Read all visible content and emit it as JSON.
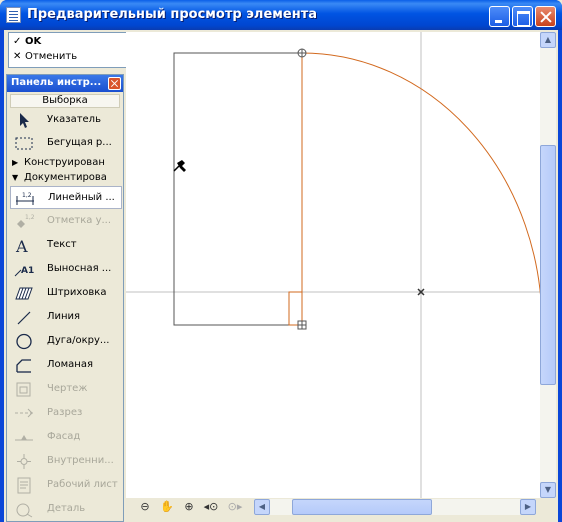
{
  "window": {
    "title": "Предварительный просмотр элемента",
    "controls": {
      "minimize": "minimize-icon",
      "maximize": "maximize-icon",
      "close": "close-icon"
    }
  },
  "dialog": {
    "ok_label": "OK",
    "cancel_label": "Отменить"
  },
  "toolbox": {
    "title": "Панель инстр...",
    "section": "Выборка",
    "select_tools": [
      {
        "label": "Указатель",
        "icon": "arrow-pointer-icon",
        "enabled": true
      },
      {
        "label": "Бегущая р...",
        "icon": "marquee-icon",
        "enabled": true
      }
    ],
    "groups": [
      {
        "label": "Конструирован",
        "expanded": false
      },
      {
        "label": "Документирова",
        "expanded": true
      }
    ],
    "doc_tools": [
      {
        "label": "Линейный ...",
        "icon": "linear-dimension-icon",
        "enabled": true,
        "selected": true
      },
      {
        "label": "Отметка у...",
        "icon": "level-dimension-icon",
        "enabled": false
      },
      {
        "label": "Текст",
        "icon": "text-icon",
        "enabled": true
      },
      {
        "label": "Выносная ...",
        "icon": "label-icon",
        "enabled": true
      },
      {
        "label": "Штриховка",
        "icon": "fill-icon",
        "enabled": true
      },
      {
        "label": "Линия",
        "icon": "line-icon",
        "enabled": true
      },
      {
        "label": "Дуга/окру...",
        "icon": "arc-circle-icon",
        "enabled": true
      },
      {
        "label": "Ломаная",
        "icon": "polyline-icon",
        "enabled": true
      },
      {
        "label": "Чертеж",
        "icon": "drawing-icon",
        "enabled": false
      },
      {
        "label": "Разрез",
        "icon": "section-icon",
        "enabled": false
      },
      {
        "label": "Фасад",
        "icon": "elevation-icon",
        "enabled": false
      },
      {
        "label": "Внутренни...",
        "icon": "interior-elevation-icon",
        "enabled": false
      },
      {
        "label": "Рабочий лист",
        "icon": "worksheet-icon",
        "enabled": false
      },
      {
        "label": "Деталь",
        "icon": "detail-icon",
        "enabled": false
      }
    ]
  },
  "navigation": {
    "zoom_tools": [
      "zoom-out-icon",
      "pan-hand-icon",
      "zoom-in-icon",
      "previous-zoom-icon",
      "next-zoom-icon"
    ]
  },
  "colors": {
    "title_bar": "#0054e3",
    "door_swing": "#d2691e",
    "door_leaf": "#d2691e",
    "outline": "#555555",
    "guide": "#c0c0c0"
  }
}
